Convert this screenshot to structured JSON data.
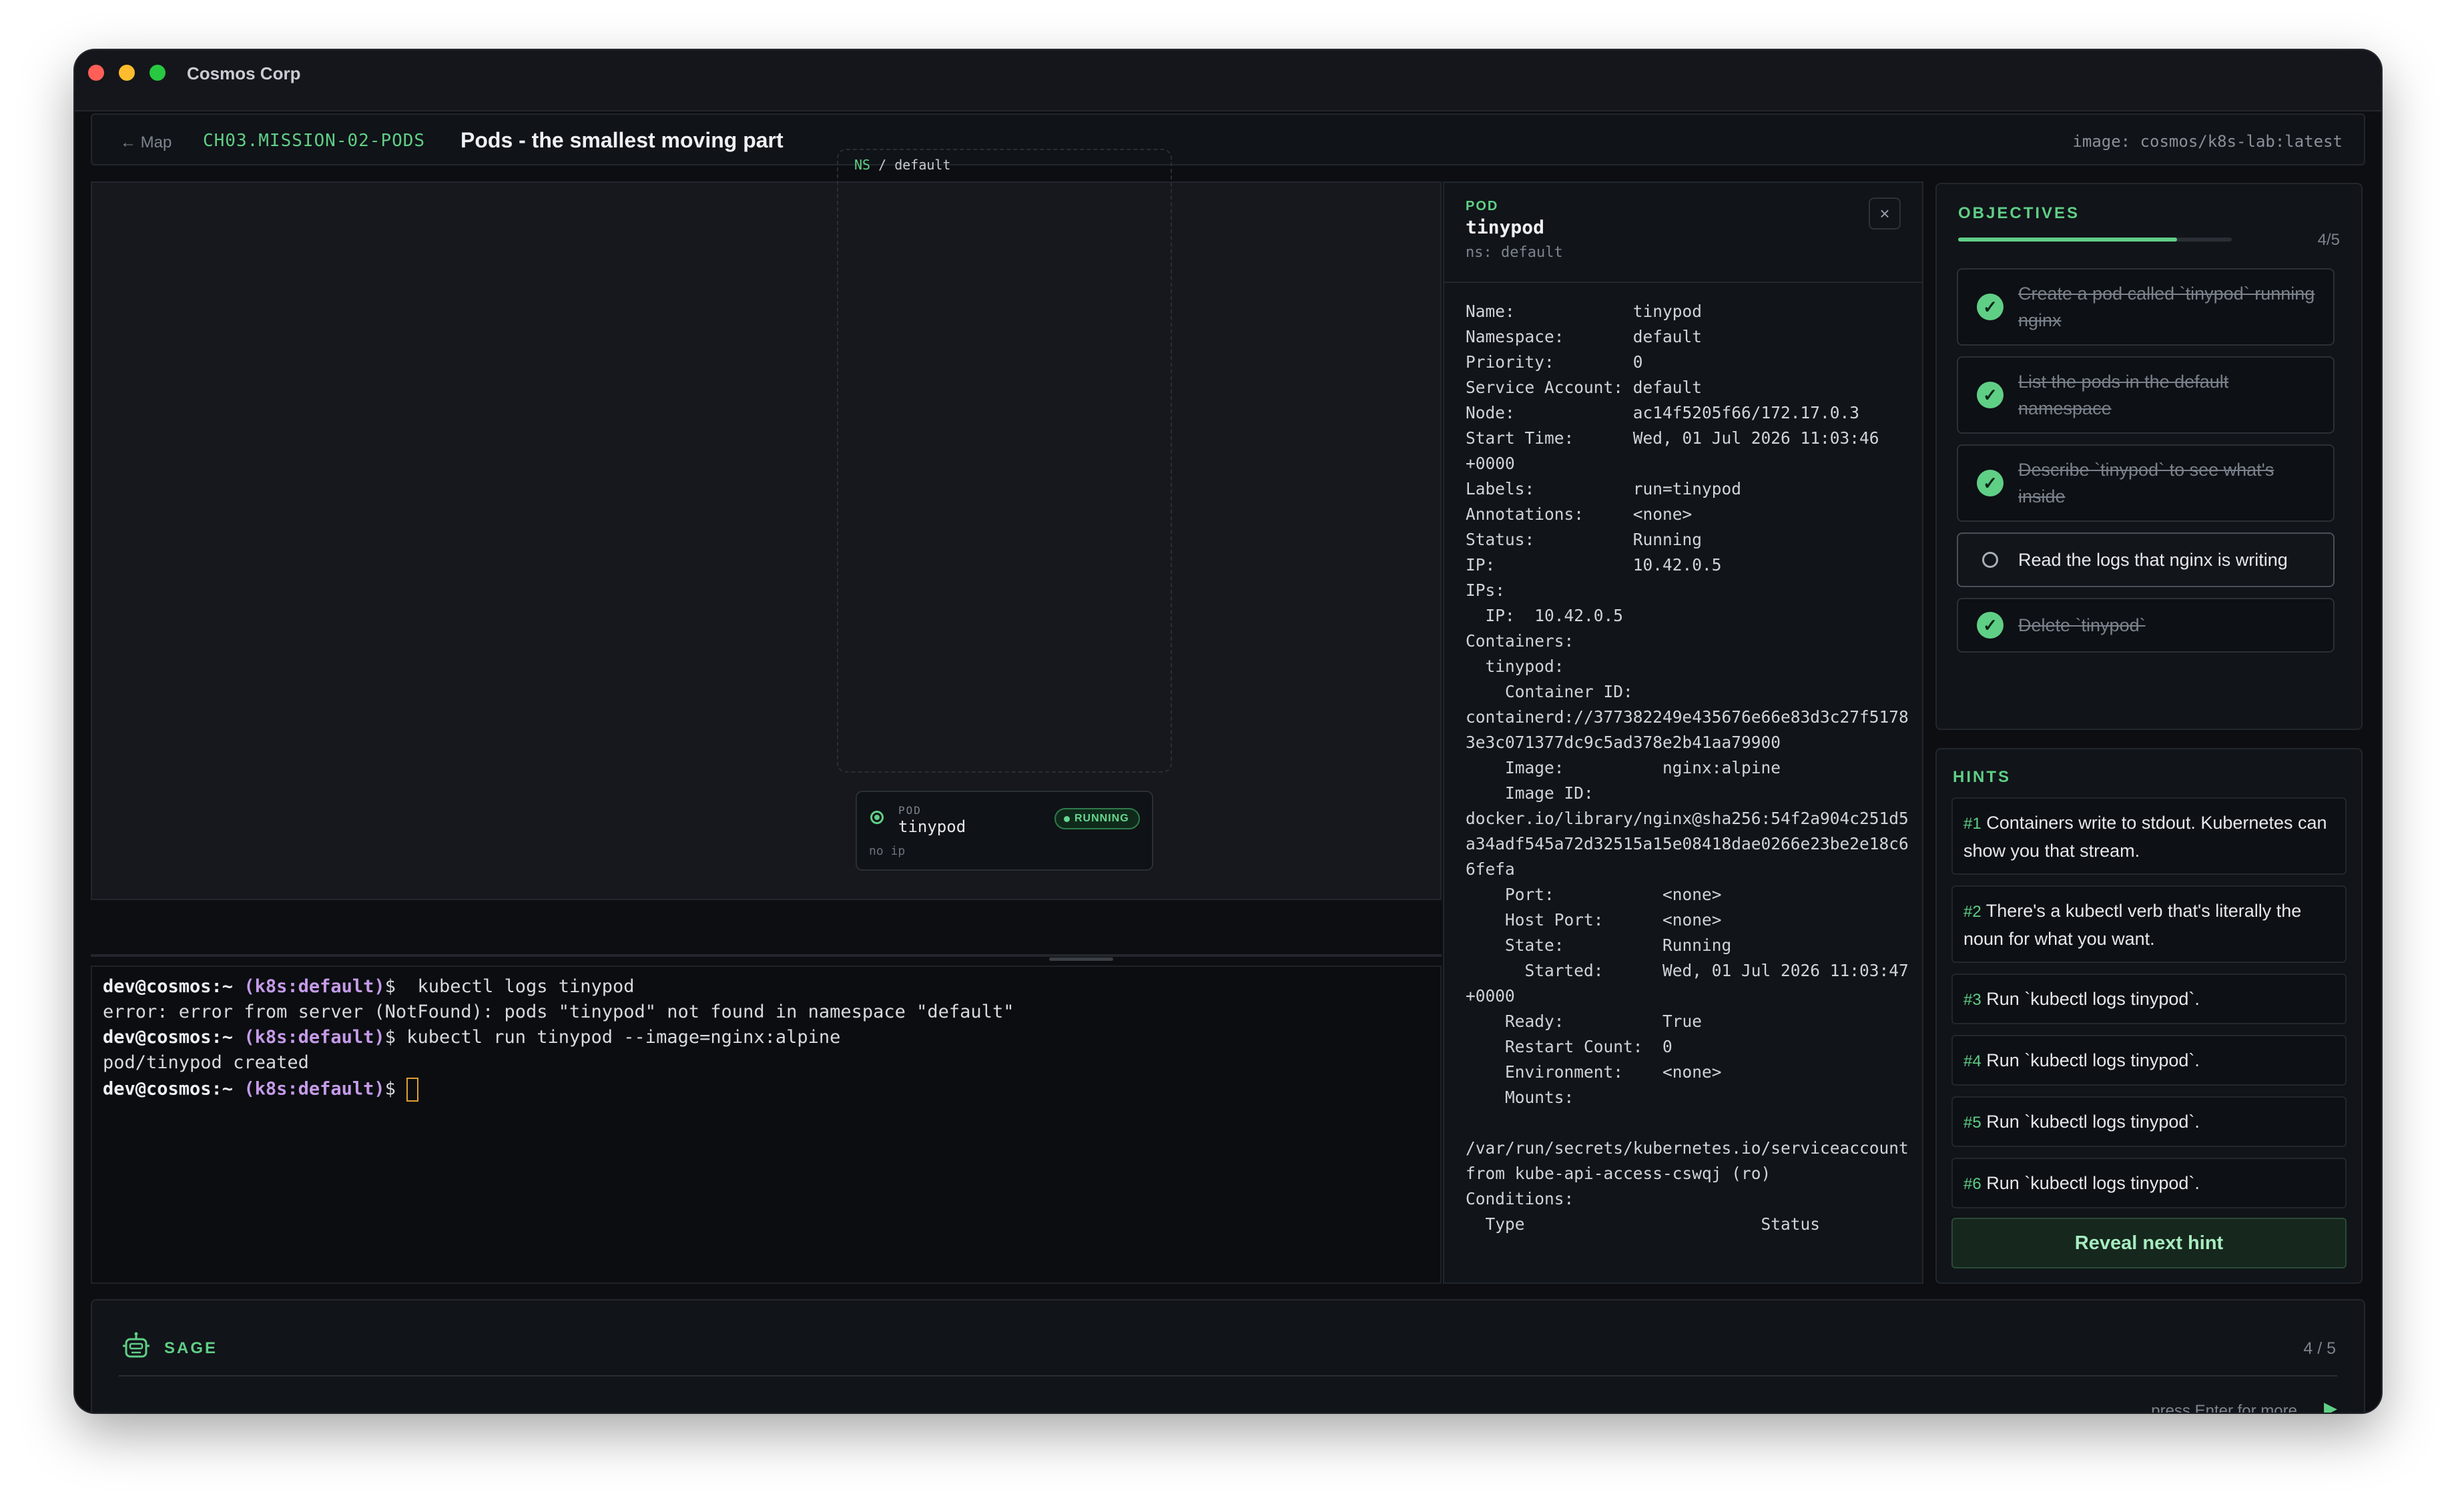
{
  "window": {
    "title": "Cosmos Corp"
  },
  "topbar": {
    "back_label": "← Map",
    "mission_id": "CH03.MISSION-02-PODS",
    "mission_title": "Pods - the smallest moving part",
    "image": "image: cosmos/k8s-lab:latest"
  },
  "cluster": {
    "ns_prefix": "NS",
    "ns_sep": " / ",
    "namespace": "default",
    "pod": {
      "kind": "POD",
      "name": "tinypod",
      "ip": "no ip",
      "status": "RUNNING"
    }
  },
  "terminal": {
    "lines": [
      {
        "user": "dev@cosmos:~",
        "ctx": "(k8s:default)",
        "sym": "$",
        "cmd": "  kubectl logs tinypod"
      },
      {
        "text": "error: error from server (NotFound): pods \"tinypod\" not found in namespace \"default\""
      },
      {
        "user": "dev@cosmos:~",
        "ctx": "(k8s:default)",
        "sym": "$",
        "cmd": " kubectl run tinypod --image=nginx:alpine"
      },
      {
        "text": "pod/tinypod created"
      },
      {
        "user": "dev@cosmos:~",
        "ctx": "(k8s:default)",
        "sym": "$",
        "cmd": " "
      }
    ]
  },
  "pod_panel": {
    "kicker": "POD",
    "name": "tinypod",
    "ns": "ns: default",
    "close": "×",
    "describe": "Name:            tinypod\nNamespace:       default\nPriority:        0\nService Account: default\nNode:            ac14f5205f66/172.17.0.3\nStart Time:      Wed, 01 Jul 2026 11:03:46\n+0000\nLabels:          run=tinypod\nAnnotations:     <none>\nStatus:          Running\nIP:              10.42.0.5\nIPs:\n  IP:  10.42.0.5\nContainers:\n  tinypod:\n    Container ID:\ncontainerd://377382249e435676e66e83d3c27f5178\n3e3c071377dc9c5ad378e2b41aa79900\n    Image:          nginx:alpine\n    Image ID:\ndocker.io/library/nginx@sha256:54f2a904c251d5\na34adf545a72d32515a15e08418dae0266e23be2e18c6\n6fefa\n    Port:           <none>\n    Host Port:      <none>\n    State:          Running\n      Started:      Wed, 01 Jul 2026 11:03:47\n+0000\n    Ready:          True\n    Restart Count:  0\n    Environment:    <none>\n    Mounts:\n\n/var/run/secrets/kubernetes.io/serviceaccount\nfrom kube-api-access-cswqj (ro)\nConditions:\n  Type                        Status"
  },
  "objectives": {
    "title": "OBJECTIVES",
    "count": "4/5",
    "progress": 0.8,
    "items": [
      {
        "label": "Create a pod called `tinypod` running nginx",
        "done": true
      },
      {
        "label": "List the pods in the default namespace",
        "done": true
      },
      {
        "label": "Describe `tinypod` to see what's inside",
        "done": true
      },
      {
        "label": "Read the logs that nginx is writing",
        "done": false
      },
      {
        "label": "Delete `tinypod`",
        "done": true
      }
    ]
  },
  "hints": {
    "title": "HINTS",
    "items": [
      {
        "num": "#1",
        "text": "Containers write to stdout. Kubernetes can show you that stream."
      },
      {
        "num": "#2",
        "text": "There's a kubectl verb that's literally the noun for what you want."
      },
      {
        "num": "#3",
        "text": "Run `kubectl logs tinypod`."
      },
      {
        "num": "#4",
        "text": "Run `kubectl logs tinypod`."
      },
      {
        "num": "#5",
        "text": "Run `kubectl logs tinypod`."
      },
      {
        "num": "#6",
        "text": "Run `kubectl logs tinypod`."
      }
    ],
    "reveal_label": "Reveal next hint"
  },
  "sage": {
    "label": "SAGE",
    "count": "4 / 5",
    "enter_hint": "press Enter for more",
    "play_icon": "▶"
  },
  "colors": {
    "accent": "#5fcf86",
    "bg": "#0c0e12",
    "panel": "#111419",
    "close_red": "#ff5f57",
    "min_yellow": "#febc2e",
    "max_green": "#28c840"
  }
}
